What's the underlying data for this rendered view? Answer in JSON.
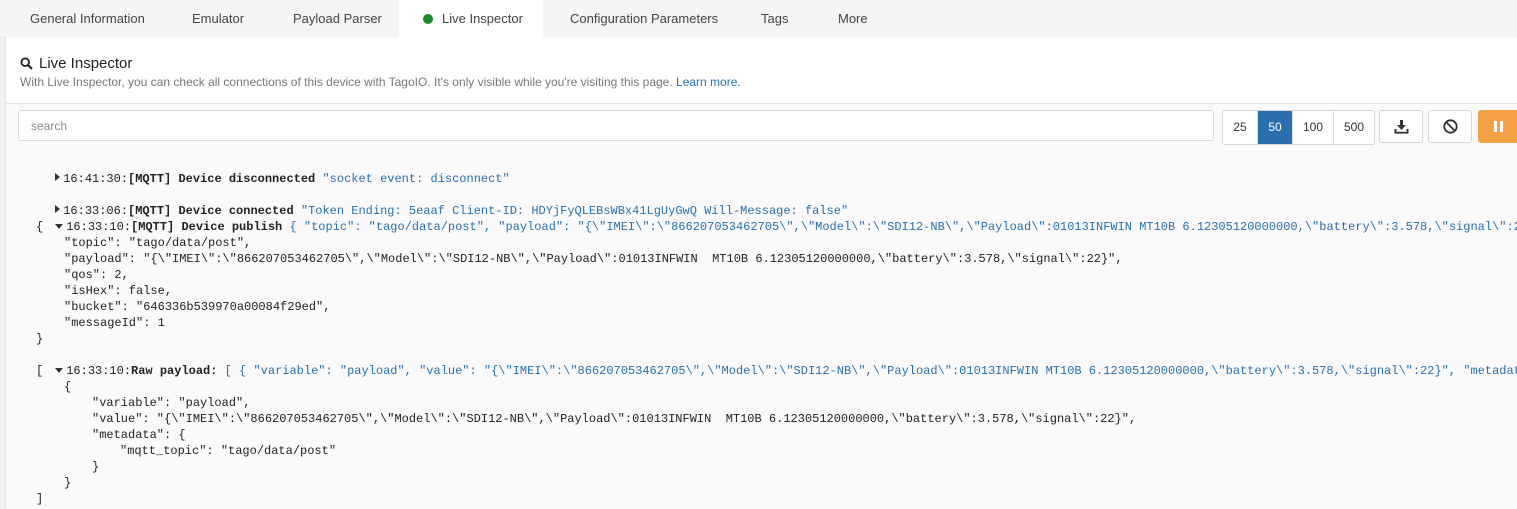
{
  "tabs": [
    {
      "label": "General Information"
    },
    {
      "label": "Emulator"
    },
    {
      "label": "Payload Parser"
    },
    {
      "label": "Live Inspector"
    },
    {
      "label": "Configuration Parameters"
    },
    {
      "label": "Tags"
    },
    {
      "label": "More"
    }
  ],
  "header": {
    "title": "Live Inspector",
    "subtitle": "With Live Inspector, you can check all connections of this device with TagoIO. It's only visible while you're visiting this page.",
    "learn_more": "Learn more."
  },
  "toolbar": {
    "search_placeholder": "search",
    "page_sizes": [
      "25",
      "50",
      "100",
      "500"
    ],
    "selected_page_size": "50"
  },
  "logs": [
    {
      "time": "16:41:30:",
      "label": "[MQTT] Device disconnected",
      "detail": "\"socket event: disconnect\""
    },
    {
      "time": "16:33:06:",
      "label": "[MQTT] Device connected",
      "detail": "\"Token Ending: 5eaaf Client-ID: HDYjFyQLEBsWBx41LgUyGwQ Will-Message: false\""
    },
    {
      "time": "16:33:10:",
      "label": "[MQTT] Device publish",
      "detail": "{ \"topic\": \"tago/data/post\", \"payload\": \"{\\\"IMEI\\\":\\\"866207053462705\\\",\\\"Model\\\":\\\"SDI12-NB\\\",\\\"Payload\\\":01013INFWIN MT10B 6.12305120000000,\\\"battery\\\":3.578,\\\"signal\\\":22}\", \"qos\": 2, \"isHex\": false, \"bucket\": \"646336b539970a00084f29ed\", \"messageId\": 1 }"
    },
    {
      "time": "16:33:10:",
      "label": "Raw payload:",
      "detail": "[ { \"variable\": \"payload\", \"value\": \"{\\\"IMEI\\\":\\\"866207053462705\\\",\\\"Model\\\":\\\"SDI12-NB\\\",\\\"Payload\\\":01013INFWIN MT10B 6.12305120000000,\\\"battery\\\":3.578,\\\"signal\\\":22}\", \"metadata\": { \"mqtt_topic\": \"tago/data/post\" } } ]"
    }
  ],
  "publish_json": [
    "{",
    "\"topic\": \"tago/data/post\",",
    "\"payload\": \"{\\\"IMEI\\\":\\\"866207053462705\\\",\\\"Model\\\":\\\"SDI12-NB\\\",\\\"Payload\\\":01013INFWIN  MT10B 6.12305120000000,\\\"battery\\\":3.578,\\\"signal\\\":22}\",",
    "\"qos\": 2,",
    "\"isHex\": false,",
    "\"bucket\": \"646336b539970a00084f29ed\",",
    "\"messageId\": 1",
    "}"
  ],
  "raw_json": [
    "[",
    "{",
    "\"variable\": \"payload\",",
    "\"value\": \"{\\\"IMEI\\\":\\\"866207053462705\\\",\\\"Model\\\":\\\"SDI12-NB\\\",\\\"Payload\\\":01013INFWIN  MT10B 6.12305120000000,\\\"battery\\\":3.578,\\\"signal\\\":22}\",",
    "\"metadata\": {",
    "\"mqtt_topic\": \"tago/data/post\"",
    "}",
    "}",
    "]"
  ],
  "colors": {
    "accent": "#2b6fad",
    "active_dot": "#1a8a2e",
    "pause": "#f5a244"
  },
  "icons": {
    "title": "search-icon",
    "download": "download-icon",
    "clear": "block-icon",
    "pause": "pause-icon"
  }
}
